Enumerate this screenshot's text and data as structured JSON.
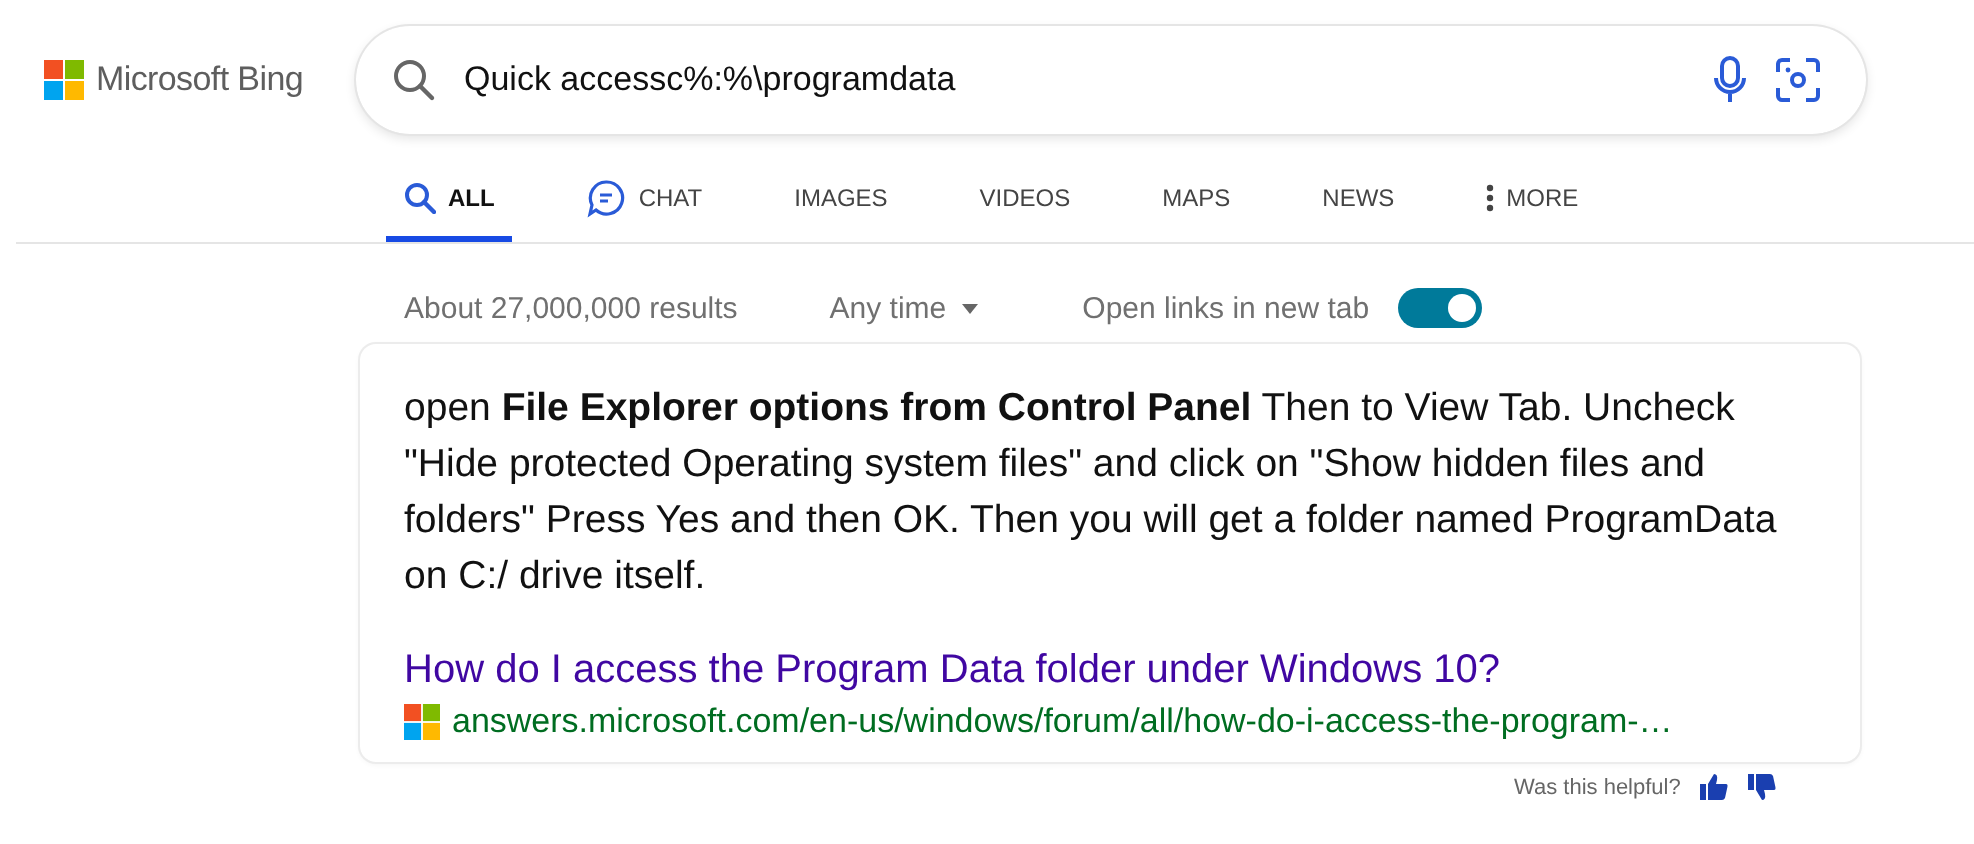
{
  "logo": {
    "text": "Microsoft Bing"
  },
  "search": {
    "value": "Quick accessc%:%\\programdata"
  },
  "tabs": [
    {
      "label": "ALL",
      "kind": "search",
      "selected": true
    },
    {
      "label": "CHAT",
      "kind": "chat",
      "selected": false
    },
    {
      "label": "IMAGES",
      "kind": "plain",
      "selected": false
    },
    {
      "label": "VIDEOS",
      "kind": "plain",
      "selected": false
    },
    {
      "label": "MAPS",
      "kind": "plain",
      "selected": false
    },
    {
      "label": "NEWS",
      "kind": "plain",
      "selected": false
    },
    {
      "label": "MORE",
      "kind": "more",
      "selected": false
    }
  ],
  "result_count": "About 27,000,000 results",
  "time_filter": "Any time",
  "new_tab_toggle": {
    "label": "Open links in new tab",
    "on": true
  },
  "answer": {
    "text": "open **File Explorer options from Control Panel** Then to View Tab. Uncheck \"Hide protected Operating system files\" and click on \"Show hidden files and folders\" Press Yes and then OK. Then you will get a folder named ProgramData on C:/ drive itself.",
    "title": "How do I access the Program Data folder under Windows 10?",
    "url": "answers.microsoft.com/en-us/windows/forum/all/how-do-i-access-the-program-…"
  },
  "feedback": {
    "label": "Was this helpful?"
  }
}
